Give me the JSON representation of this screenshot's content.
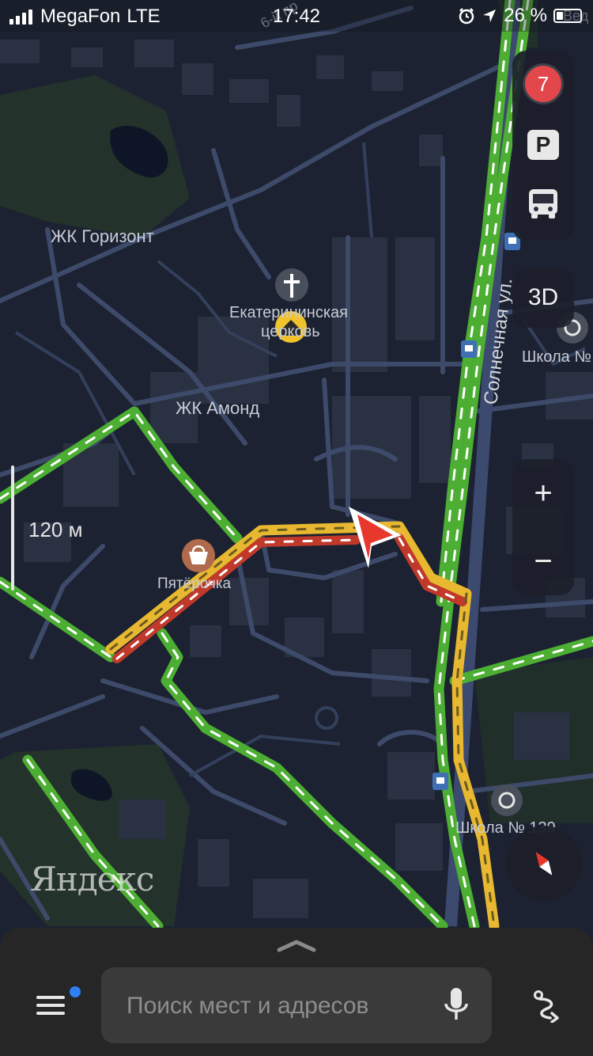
{
  "status_bar": {
    "carrier": "MegaFon",
    "network": "LTE",
    "time": "17:42",
    "battery": "26 %"
  },
  "map": {
    "labels": {
      "zk_gorizont": "ЖК Горизонт",
      "church_line1": "Екатерининская",
      "church_line2": "церковь",
      "zk_amond": "ЖК Амонд",
      "pyaterochka": "Пятёрочка",
      "street": "Солнечная ул.",
      "school_top": "Школа №",
      "school_bottom": "Школа № 139",
      "street_top": "6-й пр",
      "edge_label": "Вед"
    },
    "scale": "120 м",
    "brand": "Яндекс"
  },
  "controls": {
    "traffic_level": "7",
    "parking": "P",
    "transit": "bus-icon",
    "view3d": "3D",
    "zoom_in": "+",
    "zoom_out": "−"
  },
  "search": {
    "placeholder": "Поиск мест и адресов"
  },
  "colors": {
    "traffic_green": "#4cae32",
    "traffic_yellow": "#e8b830",
    "traffic_red": "#c0392b",
    "accent_blue": "#2f7ff5",
    "badge_red": "#e2474b"
  }
}
